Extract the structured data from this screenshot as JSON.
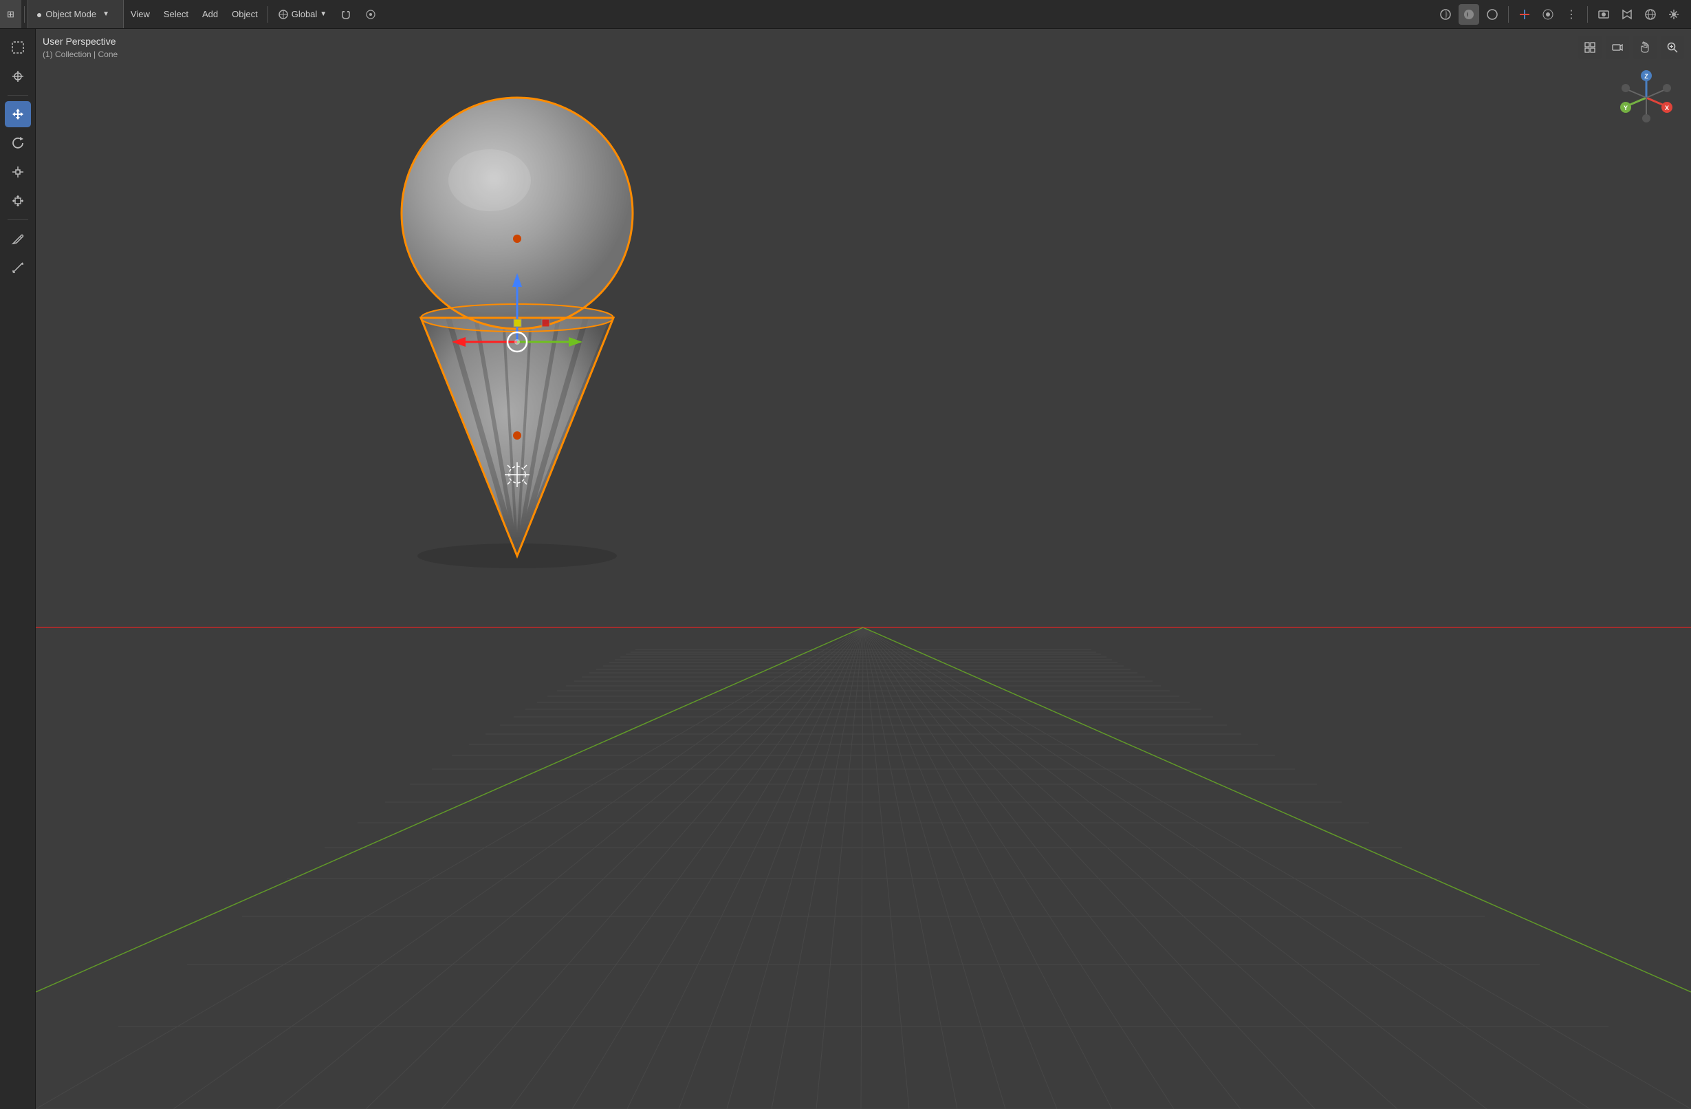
{
  "header": {
    "editor_icon": "⊞",
    "mode": "Object Mode",
    "view_label": "View",
    "select_label": "Select",
    "add_label": "Add",
    "object_label": "Object",
    "transform_label": "Global",
    "snap_label": "Snap",
    "proportional_label": "Proportional",
    "right_icons": [
      "⊟",
      "↖",
      "✋",
      "🔍",
      "📷",
      "🌐",
      "🔵",
      "⚙"
    ]
  },
  "viewport": {
    "perspective": "User Perspective",
    "collection": "(1) Collection | Cone"
  },
  "tools": [
    {
      "icon": "⬚",
      "active": false,
      "name": "select-box"
    },
    {
      "icon": "⊕",
      "active": false,
      "name": "cursor"
    },
    {
      "icon": "✛",
      "active": true,
      "name": "move"
    },
    {
      "icon": "↺",
      "active": false,
      "name": "rotate"
    },
    {
      "icon": "⊞",
      "active": false,
      "name": "scale"
    },
    {
      "icon": "⊡",
      "active": false,
      "name": "transform"
    },
    {
      "icon": "✏",
      "active": false,
      "name": "annotate"
    },
    {
      "icon": "📐",
      "active": false,
      "name": "measure"
    }
  ],
  "gizmo": {
    "x_color": "#e0443a",
    "y_color": "#75b143",
    "z_color": "#4a7fc1",
    "x_label": "X",
    "y_label": "Y",
    "z_label": "Z"
  },
  "colors": {
    "background": "#3d3d3d",
    "header_bg": "#2a2a2a",
    "toolbar_bg": "#2a2a2a",
    "active_tool": "#4772B3",
    "selection_orange": "#FF8C00",
    "grid_line": "#454545",
    "axis_x": "#FF2020",
    "axis_y": "#80FF20",
    "axis_blue": "#4080FF"
  }
}
